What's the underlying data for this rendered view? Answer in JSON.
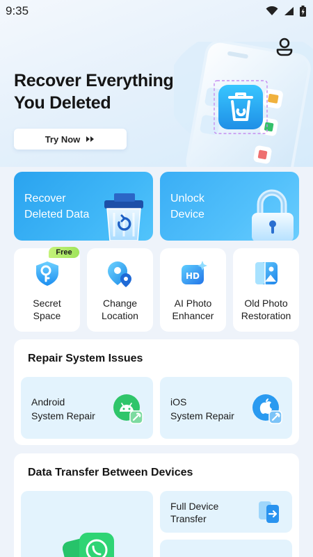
{
  "status_bar": {
    "time": "9:35",
    "icons": [
      "wifi-icon",
      "signal-icon",
      "battery-icon"
    ]
  },
  "header": {
    "profile_icon": "profile-icon"
  },
  "hero": {
    "title_line1": "Recover Everything",
    "title_line2": "You Deleted",
    "try_button": "Try Now"
  },
  "big_cards": [
    {
      "line1": "Recover",
      "line2": "Deleted Data",
      "icon": "trash-recover-icon"
    },
    {
      "line1": "Unlock",
      "line2": "Device",
      "icon": "padlock-icon"
    }
  ],
  "tools": [
    {
      "line1": "Secret",
      "line2": "Space",
      "icon": "shield-key-icon",
      "badge": "Free"
    },
    {
      "line1": "Change",
      "line2": "Location",
      "icon": "location-pin-icon"
    },
    {
      "line1": "AI Photo",
      "line2": "Enhancer",
      "icon": "hd-enhance-icon"
    },
    {
      "line1": "Old Photo",
      "line2": "Restoration",
      "icon": "photo-restore-icon"
    }
  ],
  "repair": {
    "title": "Repair System Issues",
    "items": [
      {
        "line1": "Android",
        "line2": "System Repair",
        "icon": "android-repair-icon"
      },
      {
        "line1": "iOS",
        "line2": "System Repair",
        "icon": "ios-repair-icon"
      }
    ]
  },
  "transfer": {
    "title": "Data Transfer Between Devices",
    "items": [
      {
        "line1": "Full Device",
        "line2": "Transfer",
        "icon": "phone-transfer-icon"
      }
    ]
  },
  "colors": {
    "accent": "#2aa3ef",
    "card_tint": "#e3f3fd",
    "badge": "#b6ec6c",
    "background": "#eef3fa"
  }
}
